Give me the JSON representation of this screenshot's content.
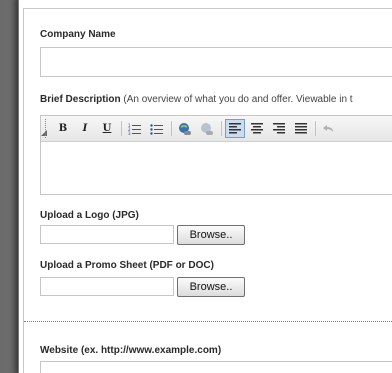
{
  "form": {
    "company_name": {
      "label": "Company Name",
      "value": ""
    },
    "brief_description": {
      "label": "Brief Description",
      "hint": "(An overview of what you do and offer. Viewable in t",
      "value": ""
    },
    "toolbar": {
      "bold": "B",
      "italic": "I",
      "underline": "U"
    },
    "logo_upload": {
      "label": "Upload a Logo (JPG)",
      "browse_label": "Browse.."
    },
    "promo_upload": {
      "label": "Upload a Promo Sheet (PDF or DOC)",
      "browse_label": "Browse.."
    },
    "website": {
      "label": "Website (ex. http://www.example.com)",
      "value": ""
    }
  },
  "colors": {
    "active_toolbar_button": "#c9dcf2",
    "divider": "#6a7fbd",
    "label_text": "#2a2a2a"
  },
  "icons": [
    "bold-icon",
    "italic-icon",
    "underline-icon",
    "ordered-list-icon",
    "unordered-list-icon",
    "link-icon",
    "unlink-icon",
    "align-left-icon",
    "align-center-icon",
    "align-right-icon",
    "align-justify-icon",
    "undo-icon"
  ]
}
